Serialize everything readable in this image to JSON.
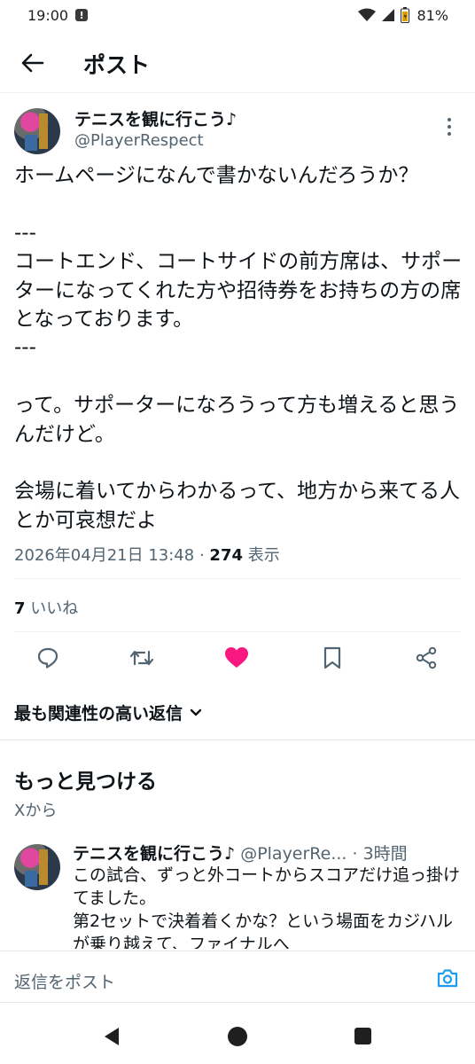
{
  "status_bar": {
    "time": "19:00",
    "notification_glyph": "!",
    "battery": "81%"
  },
  "header": {
    "title": "ポスト"
  },
  "post": {
    "author_name": "テニスを観に行こう♪",
    "author_handle": "@PlayerRespect",
    "text": "ホームページになんで書かないんだろうか？\n\n---\nコートエンド、コートサイドの前方席は、サポーターになってくれた方や招待券をお持ちの方の席となっております。\n---\n\nって。サポーターになろうって方も増えると思うんだけど。\n\n会場に着いてからわかるって、地方から来てる人とか可哀想だよ",
    "timestamp": "2026年04月21日 13:48",
    "separator": "·",
    "views_count": "274",
    "views_label": "表示",
    "likes_count": "7",
    "likes_label": "いいね",
    "liked": true,
    "like_color": "#f91880"
  },
  "sort": {
    "label": "最も関連性の高い返信"
  },
  "discover": {
    "title": "もっと見つける",
    "source": "Xから",
    "item": {
      "author_name": "テニスを観に行こう♪",
      "author_handle": "@PlayerRe...",
      "time": "· 3時間",
      "text": "この試合、ずっと外コートからスコアだけ追っ掛けてました。\n第2セットで決着着くかな？という場面をカジハルが乗り越えて、ファイナルへ"
    }
  },
  "reply": {
    "placeholder": "返信をポスト"
  },
  "colors": {
    "accent": "#1d9bf0",
    "secondary_text": "#536471",
    "like": "#f91880"
  }
}
